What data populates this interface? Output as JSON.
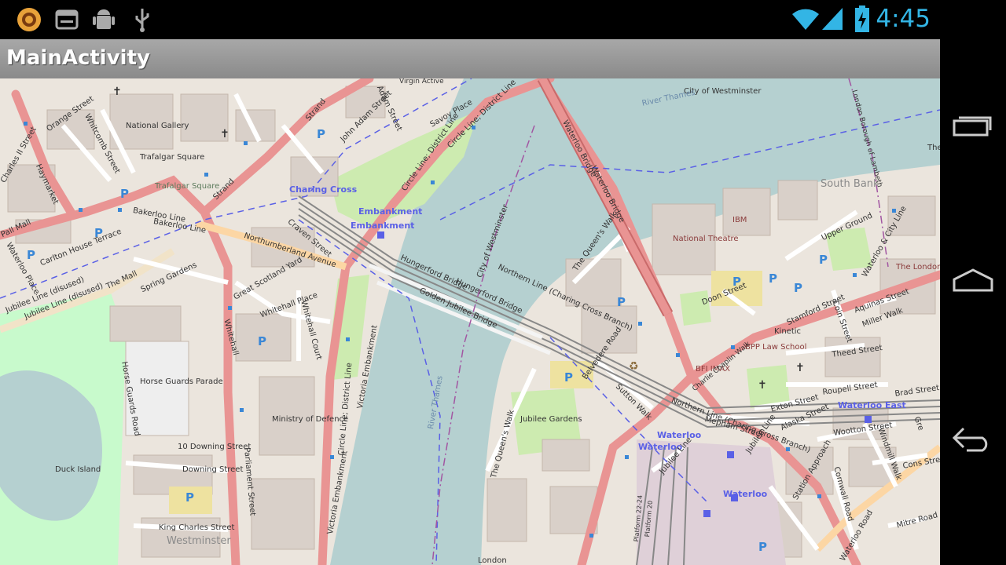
{
  "status_bar": {
    "time": "4:45",
    "left_icons": [
      "notification-app-icon",
      "screen-icon",
      "android-debug-icon",
      "usb-icon"
    ],
    "right_icons": [
      "wifi-icon",
      "cell-signal-icon",
      "battery-charging-icon"
    ]
  },
  "action_bar": {
    "title": "MainActivity"
  },
  "navigation": {
    "buttons": [
      "recent-apps",
      "home",
      "back"
    ]
  },
  "map": {
    "labels_places": [
      "National Gallery",
      "Trafalgar Square",
      "Horse Guards Parade",
      "Ministry of Defence",
      "10 Downing Street",
      "Duck Island",
      "Westminster",
      "National Theatre",
      "IBM",
      "South Bank",
      "The London Nautical School",
      "BPP Law School",
      "BFI IMAX",
      "Jubilee Gardens",
      "Virgin Active",
      "Kinetic",
      "London"
    ],
    "labels_stations": [
      "Charing Cross",
      "Embankment",
      "Embankment",
      "Waterloo",
      "Waterloo",
      "Waterloo",
      "Waterloo East"
    ],
    "labels_streets": [
      "Orange Street",
      "Whitcomb Street",
      "Trafalgar Square",
      "Charles II Street",
      "Haymarket",
      "Pall Mall",
      "Bakerloo Line",
      "Bakerloo Line",
      "Northumberland Avenue",
      "Craven Street",
      "Strand",
      "Strand",
      "John Adam Street",
      "Adam Street",
      "Savoy Place",
      "Circle Line; District Line",
      "Circle Line; District Line",
      "Carlton House Terrace",
      "The Mall",
      "Spring Gardens",
      "Great Scotland Yard",
      "Whitehall Place",
      "Whitehall Court",
      "Whitehall",
      "Parliament Street",
      "Horse Guards Road",
      "Jubilee Line (disused)",
      "Jubilee Line (disused)",
      "Waterloo Place",
      "Downing Street",
      "King Charles Street",
      "Victoria Embankment",
      "Victoria Embankment",
      "Circle Line; District Line",
      "Waterloo Bridge",
      "Waterloo Bridge",
      "Hungerford Bridge",
      "Hungerford Bridge",
      "Golden Jubilee Bridge",
      "Northern Line (Charing Cross Branch)",
      "Northern Line (Charing Cross Branch)",
      "City of Westminster",
      "City of Westminster",
      "The Queen's Walk",
      "The Queen's Walk",
      "Belvedere Road",
      "Sutton Walk",
      "Upper Ground",
      "Doon Street",
      "Stamford Street",
      "Coin Street",
      "Aquinas Street",
      "Miller Walk",
      "Theed Street",
      "Roupell Street",
      "Brad Street",
      "Exton Street",
      "Mepham Street",
      "Alaska Street",
      "Wootton Street",
      "Windmill Walk",
      "Cons Street",
      "Cornwall Road",
      "Mitre Road",
      "Station Approach",
      "Jubilee Line",
      "Waterloo & City Line",
      "London Borough of Lambeth",
      "Charlie Chaplin Walk",
      "Platform 20",
      "Platform 22-24",
      "Jubilee Line",
      "Waterloo Road",
      "River Thames",
      "River Thames",
      "The",
      "Gre"
    ]
  }
}
